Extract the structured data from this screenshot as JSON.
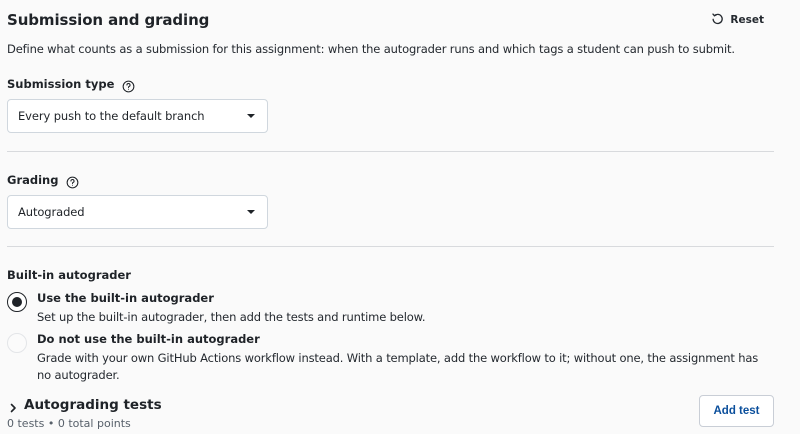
{
  "header": {
    "title": "Submission and grading",
    "reset_label": "Reset"
  },
  "description": "Define what counts as a submission for this assignment: when the autograder runs and which tags a student can push to submit.",
  "submission_type": {
    "label": "Submission type",
    "selected": "Every push to the default branch"
  },
  "grading": {
    "label": "Grading",
    "selected": "Autograded"
  },
  "autograder": {
    "label": "Built-in autograder",
    "options": [
      {
        "title": "Use the built-in autograder",
        "description": "Set up the built-in autograder, then add the tests and runtime below.",
        "checked": true
      },
      {
        "title": "Do not use the built-in autograder",
        "description": "Grade with your own GitHub Actions workflow instead. With a template, add the workflow to it; without one, the assignment has no autograder.",
        "checked": false
      }
    ]
  },
  "tests": {
    "title": "Autograding tests",
    "meta": "0 tests • 0 total points",
    "add_label": "Add test"
  },
  "icons": {
    "reset": "undo-icon",
    "help": "help-circle-icon",
    "caret": "chevron-down-icon",
    "expand": "chevron-right-icon"
  }
}
